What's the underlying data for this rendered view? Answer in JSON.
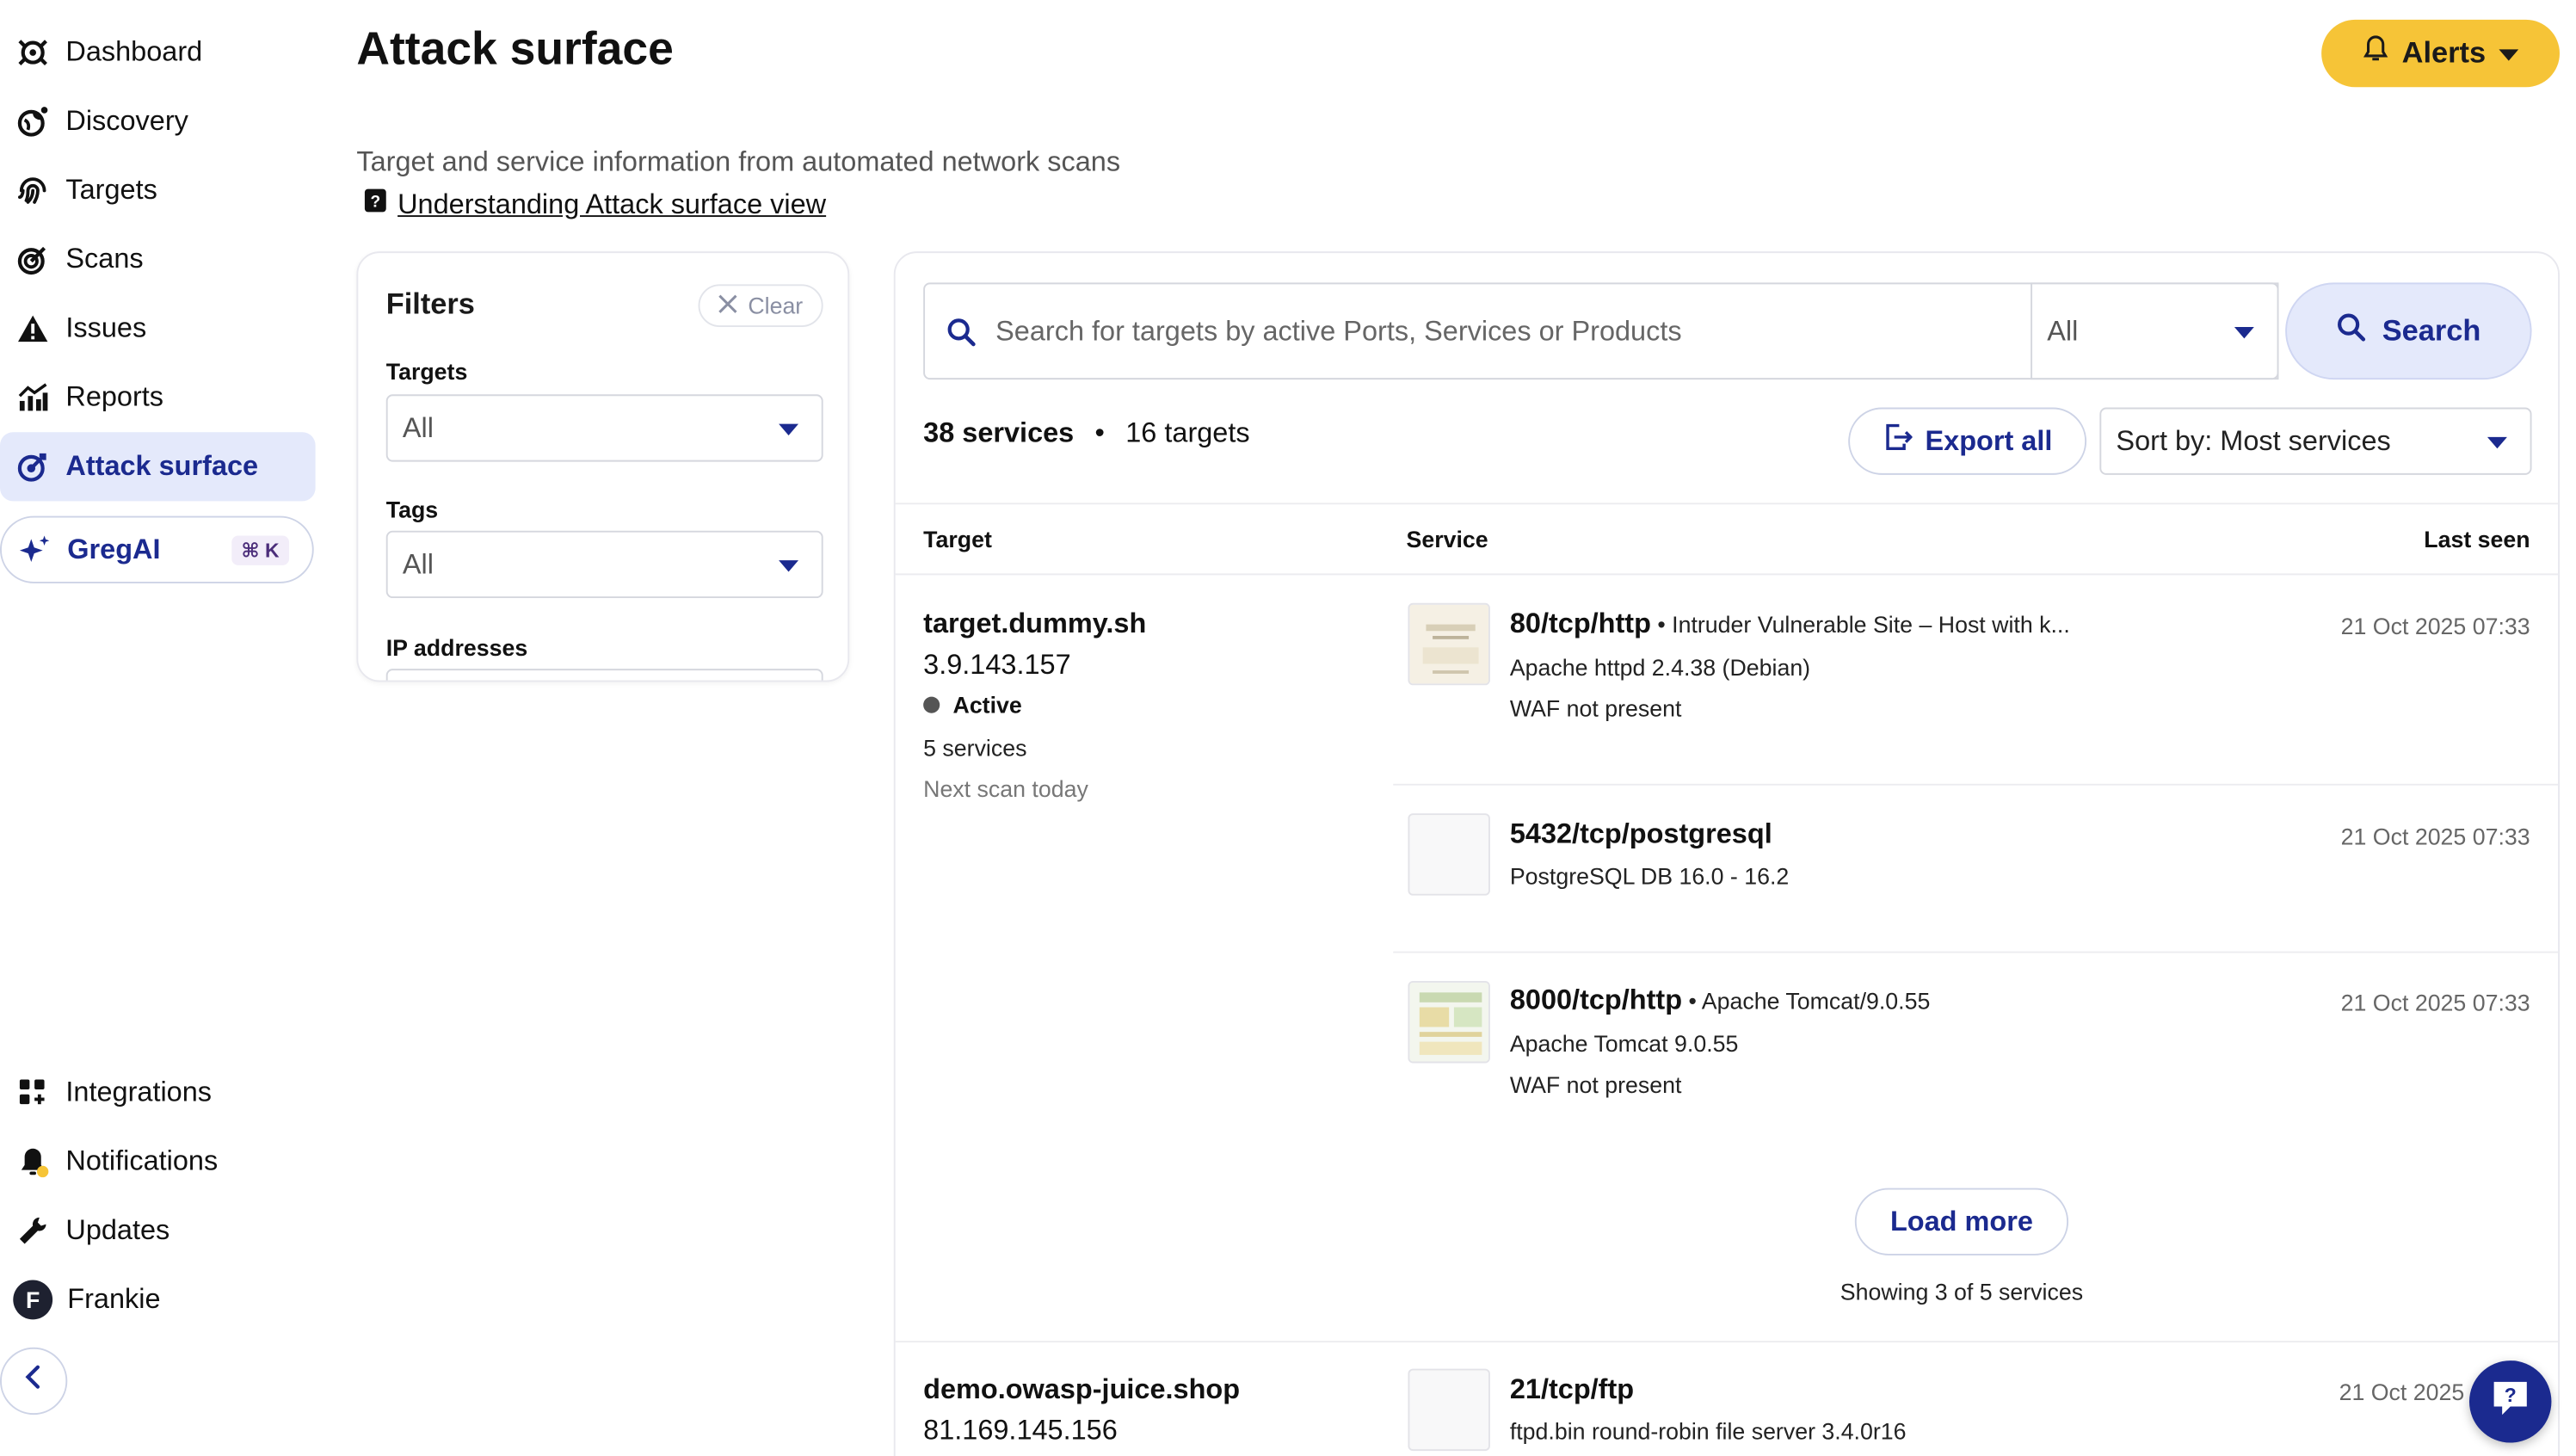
{
  "sidebar": {
    "items": [
      {
        "label": "Dashboard",
        "icon": "dashboard-icon"
      },
      {
        "label": "Discovery",
        "icon": "discovery-globe-icon"
      },
      {
        "label": "Targets",
        "icon": "targets-fingerprint-icon"
      },
      {
        "label": "Scans",
        "icon": "scans-radar-icon"
      },
      {
        "label": "Issues",
        "icon": "warning-triangle-icon"
      },
      {
        "label": "Reports",
        "icon": "chart-icon"
      },
      {
        "label": "Attack surface",
        "icon": "attack-surface-icon",
        "active": true
      }
    ],
    "gregai": {
      "label": "GregAI",
      "shortcut": "⌘ K"
    },
    "bottom_items": [
      {
        "label": "Integrations",
        "icon": "grid-icon"
      },
      {
        "label": "Notifications",
        "icon": "bell-icon"
      },
      {
        "label": "Updates",
        "icon": "wrench-icon"
      },
      {
        "label": "Frankie",
        "avatar_letter": "F"
      }
    ]
  },
  "header": {
    "title": "Attack surface",
    "alerts_label": "Alerts",
    "subtitle": "Target and service information from automated network scans",
    "help_link": "Understanding Attack surface view"
  },
  "filters": {
    "title": "Filters",
    "clear_label": "Clear",
    "targets_label": "Targets",
    "targets_value": "All",
    "tags_label": "Tags",
    "tags_value": "All",
    "ip_label": "IP addresses"
  },
  "results": {
    "search_placeholder": "Search for targets by active Ports, Services or Products",
    "search_scope": "All",
    "search_button": "Search",
    "services_count": "38 services",
    "separator": "•",
    "targets_count": "16 targets",
    "export_label": "Export all",
    "sort_label": "Sort by: Most services",
    "columns": {
      "target": "Target",
      "service": "Service",
      "last_seen": "Last seen"
    },
    "targets": [
      {
        "name": "target.dummy.sh",
        "ip": "3.9.143.157",
        "status": "Active",
        "services_count": "5 services",
        "next_scan": "Next scan today",
        "services": [
          {
            "port": "80/tcp/http",
            "extra": " • Intruder Vulnerable Site – Host with k...",
            "line1": "Apache httpd 2.4.38 (Debian)",
            "line2": "WAF not present",
            "last_seen": "21 Oct 2025 07:33"
          },
          {
            "port": "5432/tcp/postgresql",
            "extra": "",
            "line1": "PostgreSQL DB 16.0 - 16.2",
            "line2": "",
            "last_seen": "21 Oct 2025 07:33"
          },
          {
            "port": "8000/tcp/http",
            "extra": " • Apache Tomcat/9.0.55",
            "line1": "Apache Tomcat 9.0.55",
            "line2": "WAF not present",
            "last_seen": "21 Oct 2025 07:33"
          }
        ],
        "load_more": "Load more",
        "showing": "Showing 3 of 5 services"
      },
      {
        "name": "demo.owasp-juice.shop",
        "ip": "81.169.145.156",
        "services": [
          {
            "port": "21/tcp/ftp",
            "extra": "",
            "line1": "ftpd.bin round-robin file server 3.4.0r16",
            "last_seen": "21 Oct 2025"
          }
        ]
      }
    ]
  },
  "colors": {
    "accent": "#1b2a8f",
    "alerts": "#f6c437",
    "active_bg": "#e4e9fb"
  }
}
